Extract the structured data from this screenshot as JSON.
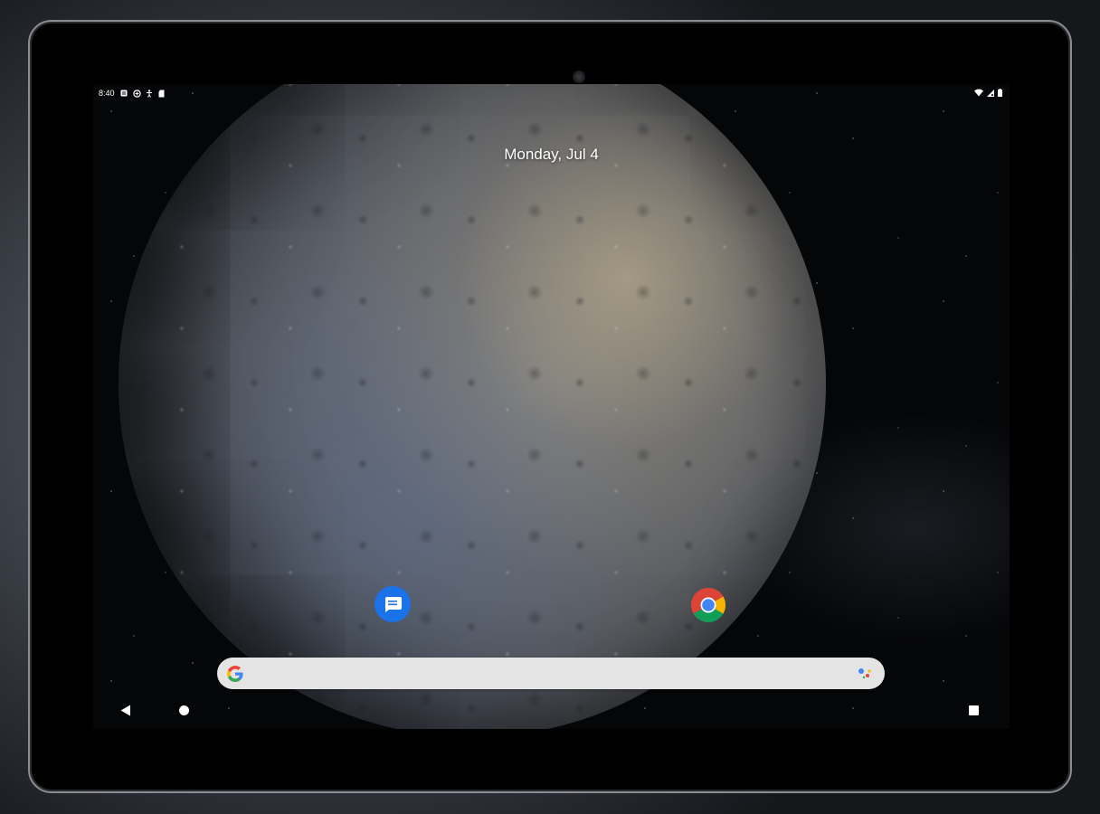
{
  "status_bar": {
    "time": "8:40",
    "left_icons": [
      "notification-icon",
      "data-saver-icon",
      "accessibility-icon",
      "sd-card-icon"
    ],
    "right_icons": [
      "wifi-icon",
      "signal-icon",
      "battery-icon"
    ]
  },
  "home": {
    "date": "Monday, Jul 4"
  },
  "apps": [
    {
      "name": "Messages",
      "icon": "messages-icon",
      "color": "#1a73e8"
    },
    {
      "name": "Chrome",
      "icon": "chrome-icon",
      "colors": [
        "#db4437",
        "#f4b400",
        "#0f9d58",
        "#4285f4"
      ]
    }
  ],
  "search": {
    "value": "",
    "placeholder": "",
    "logo": "google-g-icon",
    "trailing_icon": "assistant-icon"
  },
  "nav_bar": {
    "buttons": [
      "back-icon",
      "home-icon",
      "recents-icon"
    ]
  }
}
